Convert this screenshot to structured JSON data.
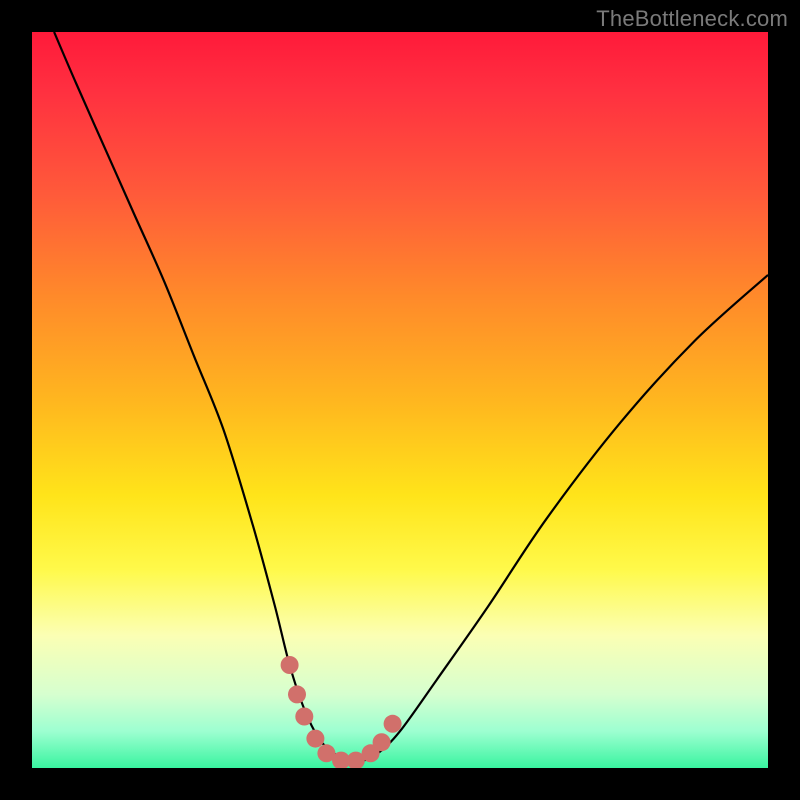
{
  "watermark": "TheBottleneck.com",
  "chart_data": {
    "type": "line",
    "title": "",
    "xlabel": "",
    "ylabel": "",
    "xlim": [
      0,
      100
    ],
    "ylim": [
      0,
      100
    ],
    "series": [
      {
        "name": "bottleneck-curve",
        "x": [
          3,
          6,
          10,
          14,
          18,
          22,
          26,
          30,
          33,
          35,
          37,
          39,
          41,
          43,
          45,
          47,
          50,
          55,
          62,
          70,
          80,
          90,
          100
        ],
        "values": [
          100,
          93,
          84,
          75,
          66,
          56,
          46,
          33,
          22,
          14,
          8,
          4,
          2,
          1,
          1,
          2,
          5,
          12,
          22,
          34,
          47,
          58,
          67
        ]
      }
    ],
    "markers": {
      "name": "highlight-dots",
      "color": "#d1706b",
      "x": [
        35,
        36,
        37,
        38.5,
        40,
        42,
        44,
        46,
        47.5,
        49
      ],
      "values": [
        14,
        10,
        7,
        4,
        2,
        1,
        1,
        2,
        3.5,
        6
      ]
    },
    "gradient_stops": [
      {
        "pos": 0,
        "color": "#ff1a3a"
      },
      {
        "pos": 22,
        "color": "#ff5a3a"
      },
      {
        "pos": 50,
        "color": "#ffb61f"
      },
      {
        "pos": 73,
        "color": "#fff94a"
      },
      {
        "pos": 90,
        "color": "#d6ffcf"
      },
      {
        "pos": 100,
        "color": "#39f4a0"
      }
    ]
  }
}
